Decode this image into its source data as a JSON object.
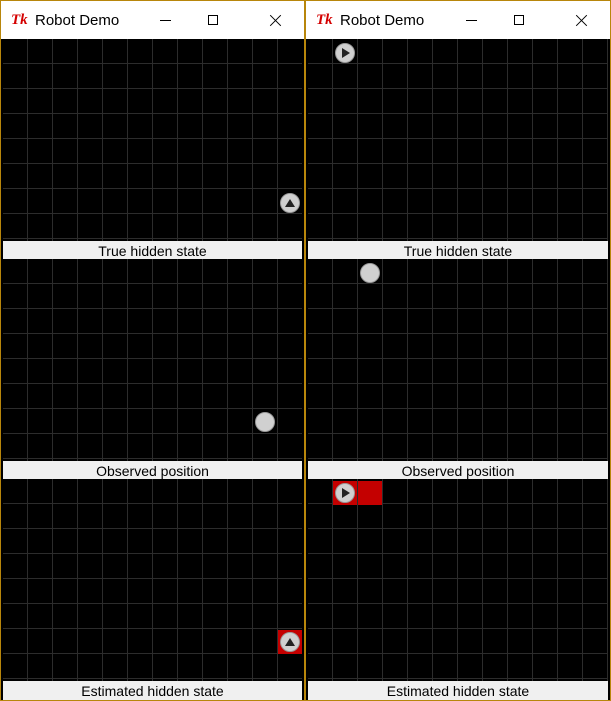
{
  "app": {
    "icon": "Tk",
    "icon_name": "tk-feather-icon"
  },
  "colors": {
    "background": "#000000",
    "grid": "#2c2c2c",
    "robot": "#d0d0d0",
    "estimate_highlight": "#c40000",
    "label_bg": "#f0f0f0"
  },
  "windows": [
    {
      "title": "Robot Demo",
      "panels": [
        {
          "label": "True hidden state",
          "robot_heading": "up"
        },
        {
          "label": "Observed position"
        },
        {
          "label": "Estimated hidden state",
          "robot_heading": "up",
          "highlighted_cells": 1
        }
      ]
    },
    {
      "title": "Robot Demo",
      "panels": [
        {
          "label": "True hidden state",
          "robot_heading": "right"
        },
        {
          "label": "Observed position"
        },
        {
          "label": "Estimated hidden state",
          "robot_heading": "right",
          "highlighted_cells": 2
        }
      ]
    }
  ]
}
